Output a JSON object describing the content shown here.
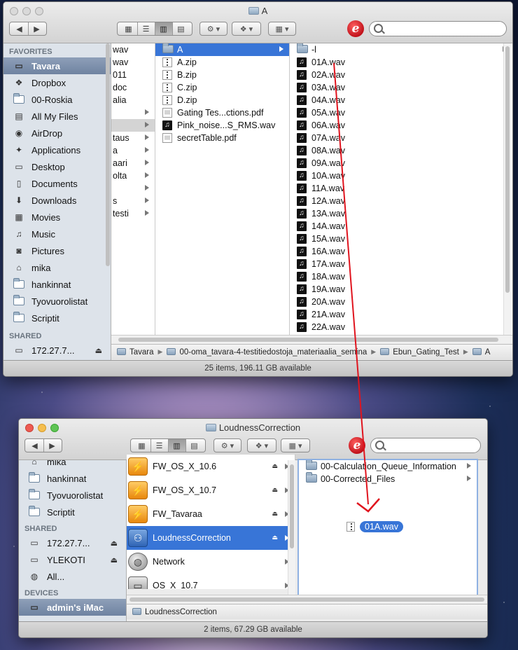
{
  "top_window": {
    "title": "A",
    "sidebar": {
      "favorites_header": "FAVORITES",
      "items": [
        {
          "label": "Tavara",
          "icon": "drive-icon",
          "selected": true
        },
        {
          "label": "Dropbox",
          "icon": "dropbox-icon"
        },
        {
          "label": "00-Roskia",
          "icon": "folder-icon"
        },
        {
          "label": "All My Files",
          "icon": "all-files-icon"
        },
        {
          "label": "AirDrop",
          "icon": "airdrop-icon"
        },
        {
          "label": "Applications",
          "icon": "applications-icon"
        },
        {
          "label": "Desktop",
          "icon": "desktop-icon"
        },
        {
          "label": "Documents",
          "icon": "documents-icon"
        },
        {
          "label": "Downloads",
          "icon": "downloads-icon"
        },
        {
          "label": "Movies",
          "icon": "movies-icon"
        },
        {
          "label": "Music",
          "icon": "music-icon"
        },
        {
          "label": "Pictures",
          "icon": "pictures-icon"
        },
        {
          "label": "mika",
          "icon": "home-icon"
        },
        {
          "label": "hankinnat",
          "icon": "folder-icon"
        },
        {
          "label": "Tyovuorolistat",
          "icon": "folder-icon"
        },
        {
          "label": "Scriptit",
          "icon": "folder-icon"
        }
      ],
      "shared_header": "SHARED",
      "shared_items": [
        {
          "label": "172.27.7...",
          "icon": "computer-icon"
        }
      ]
    },
    "col1_fragments": [
      "wav",
      "wav",
      "011",
      "doc",
      "alia",
      "",
      "",
      "taus",
      "a",
      "aari",
      "olta",
      "",
      "s",
      "testi"
    ],
    "col2": [
      {
        "name": "A",
        "type": "folder",
        "selected": true,
        "arrow": true
      },
      {
        "name": "A.zip",
        "type": "zip"
      },
      {
        "name": "B.zip",
        "type": "zip"
      },
      {
        "name": "C.zip",
        "type": "zip"
      },
      {
        "name": "D.zip",
        "type": "zip"
      },
      {
        "name": "Gating Tes...ctions.pdf",
        "type": "pdf"
      },
      {
        "name": "Pink_noise...S_RMS.wav",
        "type": "music"
      },
      {
        "name": "secretTable.pdf",
        "type": "pdf"
      }
    ],
    "col3": [
      {
        "name": "-l",
        "type": "folder",
        "arrow": true
      },
      {
        "name": "01A.wav"
      },
      {
        "name": "02A.wav"
      },
      {
        "name": "03A.wav"
      },
      {
        "name": "04A.wav"
      },
      {
        "name": "05A.wav"
      },
      {
        "name": "06A.wav"
      },
      {
        "name": "07A.wav"
      },
      {
        "name": "08A.wav"
      },
      {
        "name": "09A.wav"
      },
      {
        "name": "10A.wav"
      },
      {
        "name": "11A.wav"
      },
      {
        "name": "12A.wav"
      },
      {
        "name": "13A.wav"
      },
      {
        "name": "14A.wav"
      },
      {
        "name": "15A.wav"
      },
      {
        "name": "16A.wav"
      },
      {
        "name": "17A.wav"
      },
      {
        "name": "18A.wav"
      },
      {
        "name": "19A.wav"
      },
      {
        "name": "20A.wav"
      },
      {
        "name": "21A.wav"
      },
      {
        "name": "22A.wav"
      }
    ],
    "path": [
      "Tavara",
      "00-oma_tavara-4-testitiedostoja_materiaalia_semina",
      "Ebun_Gating_Test",
      "A"
    ],
    "status": "25 items, 196.11 GB available"
  },
  "bottom_window": {
    "title": "LoudnessCorrection",
    "sidebar": {
      "items": [
        {
          "label": "mika",
          "icon": "home-icon"
        },
        {
          "label": "hankinnat",
          "icon": "folder-icon"
        },
        {
          "label": "Tyovuorolistat",
          "icon": "folder-icon"
        },
        {
          "label": "Scriptit",
          "icon": "folder-icon"
        }
      ],
      "shared_header": "SHARED",
      "shared_items": [
        {
          "label": "172.27.7...",
          "icon": "computer-icon",
          "eject": true
        },
        {
          "label": "YLEKOTI",
          "icon": "computer-icon",
          "eject": true
        },
        {
          "label": "All...",
          "icon": "network-icon"
        }
      ],
      "devices_header": "DEVICES",
      "device_items": [
        {
          "label": "admin's iMac",
          "icon": "imac-icon",
          "selected": true
        }
      ]
    },
    "volumes": [
      {
        "name": "FW_OS_X_10.6",
        "kind": "orange",
        "eject": true
      },
      {
        "name": "FW_OS_X_10.7",
        "kind": "orange",
        "eject": true
      },
      {
        "name": "FW_Tavaraa",
        "kind": "orange",
        "eject": true
      },
      {
        "name": "LoudnessCorrection",
        "kind": "blue",
        "eject": true,
        "selected": true
      },
      {
        "name": "Network",
        "kind": "globe"
      },
      {
        "name": "OS_X_10.7",
        "kind": "disk"
      }
    ],
    "folders": [
      {
        "name": "00-Calculation_Queue_Information"
      },
      {
        "name": "00-Corrected_Files"
      }
    ],
    "dragged_file": "01A.wav",
    "path": [
      "LoudnessCorrection"
    ],
    "status": "2 items, 67.29 GB available"
  },
  "annotation": {
    "color": "#e0141e"
  }
}
